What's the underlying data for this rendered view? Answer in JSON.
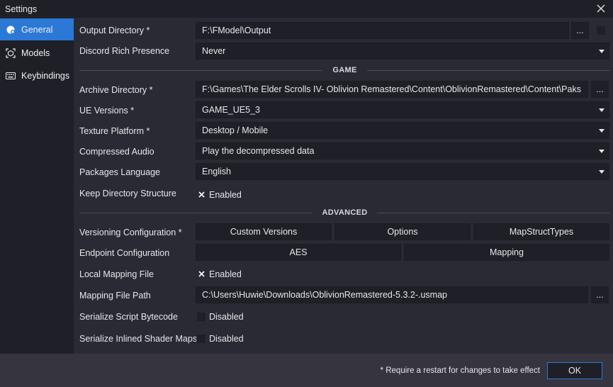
{
  "window": {
    "title": "Settings"
  },
  "sidebar": {
    "items": [
      {
        "label": "General",
        "icon": "general-icon",
        "active": true
      },
      {
        "label": "Models",
        "icon": "models-icon",
        "active": false
      },
      {
        "label": "Keybindings",
        "icon": "keyboard-icon",
        "active": false
      }
    ]
  },
  "general": {
    "output_directory": {
      "label": "Output Directory *",
      "value": "F:\\FModel\\Output",
      "browse": "..."
    },
    "discord": {
      "label": "Discord Rich Presence",
      "value": "Never"
    }
  },
  "game": {
    "section": "GAME",
    "archive_directory": {
      "label": "Archive Directory *",
      "value": "F:\\Games\\The Elder Scrolls IV- Oblivion Remastered\\Content\\OblivionRemastered\\Content\\Paks",
      "browse": "..."
    },
    "ue_versions": {
      "label": "UE Versions *",
      "value": "GAME_UE5_3"
    },
    "texture_platform": {
      "label": "Texture Platform *",
      "value": "Desktop / Mobile"
    },
    "compressed_audio": {
      "label": "Compressed Audio",
      "value": "Play the decompressed data"
    },
    "packages_language": {
      "label": "Packages Language",
      "value": "English"
    },
    "keep_directory": {
      "label": "Keep Directory Structure",
      "state": "Enabled"
    }
  },
  "advanced": {
    "section": "ADVANCED",
    "versioning": {
      "label": "Versioning Configuration *",
      "buttons": [
        "Custom Versions",
        "Options",
        "MapStructTypes"
      ]
    },
    "endpoint": {
      "label": "Endpoint Configuration",
      "buttons": [
        "AES",
        "Mapping"
      ]
    },
    "local_mapping": {
      "label": "Local Mapping File",
      "state": "Enabled"
    },
    "mapping_path": {
      "label": "Mapping File Path",
      "value": "C:\\Users\\Huwie\\Downloads\\OblivionRemastered-5.3.2-.usmap",
      "browse": "..."
    },
    "serialize_script": {
      "label": "Serialize Script Bytecode",
      "state": "Disabled"
    },
    "serialize_shader": {
      "label": "Serialize Inlined Shader Maps",
      "state": "Disabled"
    }
  },
  "footer": {
    "note": "* Require a restart for changes to take effect",
    "ok": "OK"
  },
  "colors": {
    "accent": "#2b78d6",
    "background": "#2a2a34",
    "field": "#1f1f27"
  }
}
